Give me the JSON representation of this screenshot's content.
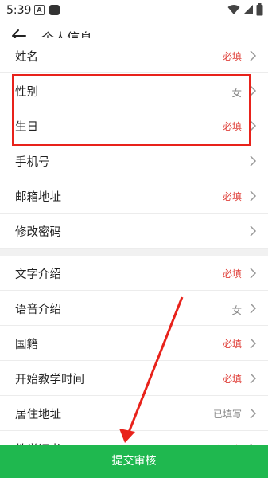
{
  "status_bar": {
    "time": "5:39",
    "a_icon_letter": "A"
  },
  "app_bar": {
    "title": "个人信息"
  },
  "rows": [
    {
      "label": "姓名",
      "value": "必填",
      "value_type": "required"
    },
    {
      "label": "性别",
      "value": "女",
      "value_type": "filled"
    },
    {
      "label": "生日",
      "value": "必填",
      "value_type": "required"
    },
    {
      "label": "手机号",
      "value": "",
      "value_type": "none"
    },
    {
      "label": "邮箱地址",
      "value": "必填",
      "value_type": "required"
    },
    {
      "label": "修改密码",
      "value": "",
      "value_type": "none"
    },
    {
      "label": "文字介绍",
      "value": "必填",
      "value_type": "required"
    },
    {
      "label": "语音介绍",
      "value": "女",
      "value_type": "filled"
    },
    {
      "label": "国籍",
      "value": "必填",
      "value_type": "required"
    },
    {
      "label": "开始教学时间",
      "value": "必填",
      "value_type": "required"
    },
    {
      "label": "居住地址",
      "value": "已填写",
      "value_type": "gray"
    },
    {
      "label": "教学证书",
      "value": "上传证书",
      "value_type": "required"
    }
  ],
  "submit_button": {
    "label": "提交审核"
  },
  "colors": {
    "accent_green": "#1fb84f",
    "required_red": "#e0413b",
    "highlight_red": "#e8221b"
  }
}
